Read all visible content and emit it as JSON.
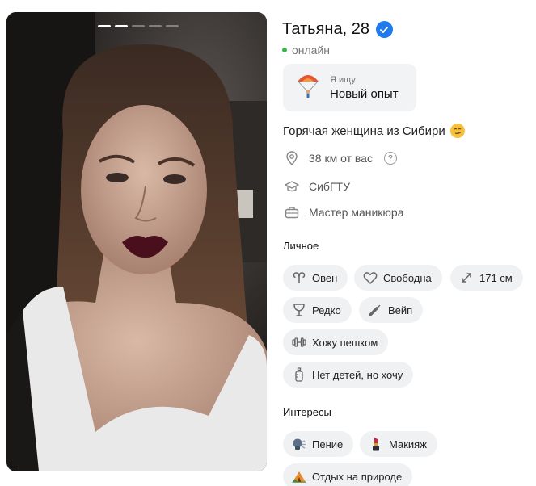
{
  "profile": {
    "name": "Татьяна, 28",
    "status": "онлайн",
    "looking_for": {
      "label": "Я ищу",
      "value": "Новый опыт"
    },
    "bio": "Горячая женщина из Сибири",
    "distance": "38 км от вас",
    "education": "СибГТУ",
    "job": "Мастер маникюра"
  },
  "photos": {
    "count": 5,
    "active_index": 1
  },
  "personal": {
    "title": "Личное",
    "chips": [
      {
        "label": "Овен",
        "icon": "aries-icon"
      },
      {
        "label": "Свободна",
        "icon": "heart-icon"
      },
      {
        "label": "171 см",
        "icon": "height-icon"
      },
      {
        "label": "Редко",
        "icon": "glass-icon"
      },
      {
        "label": "Вейп",
        "icon": "vape-icon"
      },
      {
        "label": "Хожу пешком",
        "icon": "dumbbell-icon"
      },
      {
        "label": "Нет детей, но хочу",
        "icon": "baby-bottle-icon"
      }
    ]
  },
  "interests": {
    "title": "Интересы",
    "chips": [
      {
        "label": "Пение",
        "icon": "singing-icon"
      },
      {
        "label": "Макияж",
        "icon": "lipstick-icon"
      },
      {
        "label": "Отдых на природе",
        "icon": "camping-icon"
      }
    ]
  },
  "colors": {
    "verified": "#1f7aec",
    "online": "#3bb54a",
    "chip_bg": "#f0f1f3"
  }
}
